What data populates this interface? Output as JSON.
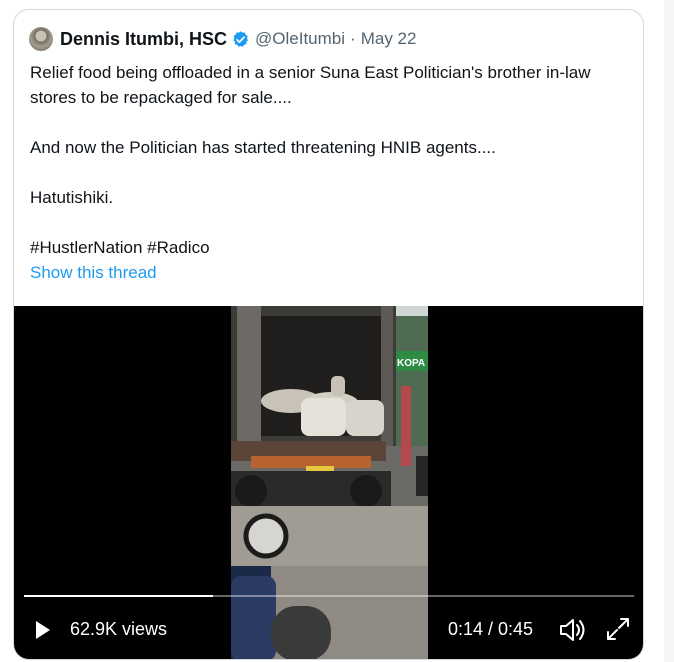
{
  "tweet": {
    "author_name": "Dennis Itumbi, HSC",
    "handle": "@OleItumbi",
    "separator": "·",
    "date": "May 22",
    "lines": [
      "Relief food being offloaded in a senior Suna East Politician's brother in-law stores to be repackaged for sale....",
      "And now the Politician has started threatening HNIB agents....",
      "Hatutishiki.",
      "#HustlerNation #Radico"
    ],
    "show_thread": "Show this thread"
  },
  "video": {
    "views": "62.9K views",
    "time": "0:14 / 0:45",
    "progress": 0.31,
    "truck_sign": "KOPA",
    "icons": [
      "play-icon",
      "volume-icon",
      "fullscreen-icon"
    ]
  },
  "colors": {
    "link": "#1d9bf0",
    "verified": "#1d9bf0",
    "muted": "#536471"
  }
}
